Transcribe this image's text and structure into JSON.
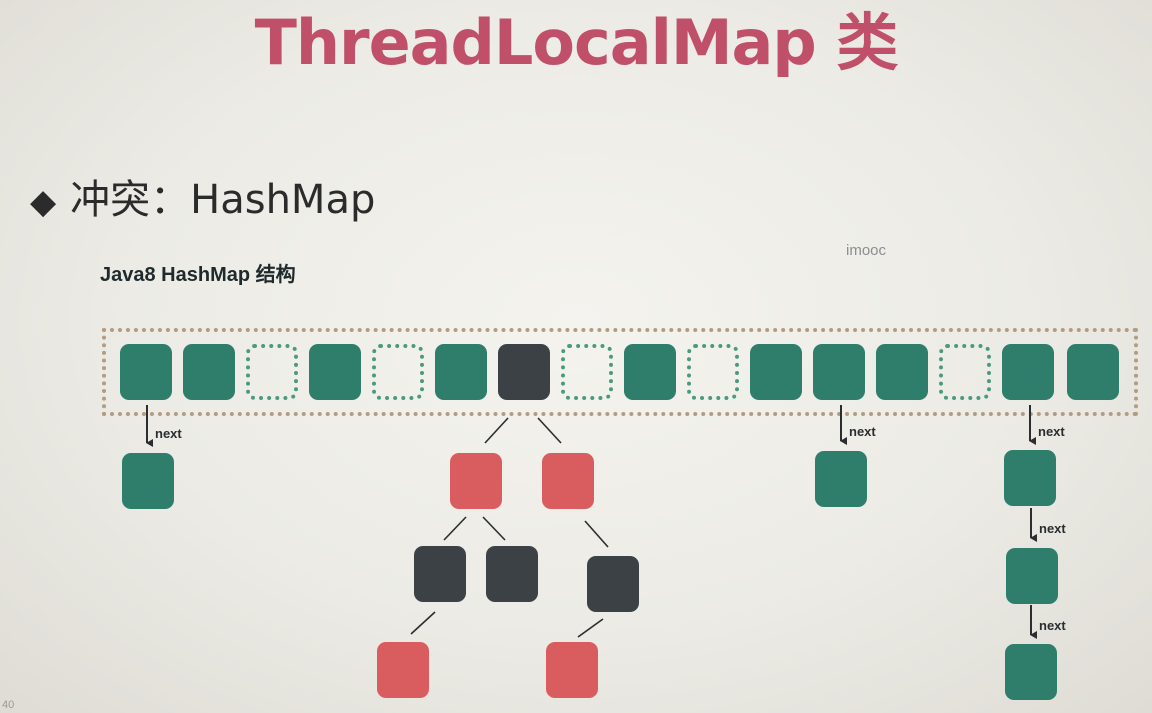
{
  "slide": {
    "title": "ThreadLocalMap 类",
    "bullet_icon": "◆",
    "bullet_text": "冲突：HashMap",
    "subtitle": "Java8 HashMap 结构",
    "watermark": "imooc",
    "page_number": "40"
  },
  "diagram": {
    "bucket_states": [
      "filled",
      "filled",
      "empty",
      "filled",
      "empty",
      "filled",
      "tree-root",
      "empty",
      "filled",
      "empty",
      "filled",
      "filled",
      "filled",
      "empty",
      "filled",
      "filled"
    ],
    "link_label": "next",
    "colors": {
      "bucket": "#2f7e6c",
      "empty_outline": "#4a9a80",
      "tree_black": "#3b4145",
      "tree_red": "#d95d5f",
      "title": "#c0506a",
      "frame": "#b39c80"
    }
  }
}
